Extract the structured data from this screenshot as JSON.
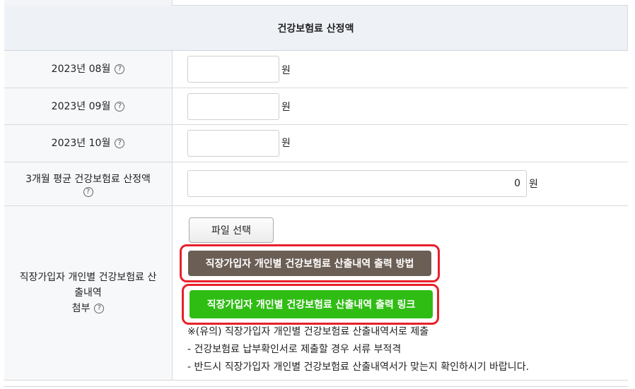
{
  "section": {
    "title": "건강보험료 산정액"
  },
  "rows": [
    {
      "label": "2023년 08월",
      "value": "",
      "unit": "원"
    },
    {
      "label": "2023년 09월",
      "value": "",
      "unit": "원"
    },
    {
      "label": "2023년 10월",
      "value": "",
      "unit": "원"
    }
  ],
  "average": {
    "label": "3개월 평균 건강보험료 산정액",
    "value": "0",
    "unit": "원"
  },
  "attachment": {
    "label_line1": "직장가입자 개인별 건강보험료 산",
    "label_line2": "출내역",
    "label_line3": "첨부",
    "file_button": "파일 선택",
    "howto_button": "직장가입자 개인별 건강보험료 산출내역 출력 방법",
    "link_button": "직장가입자 개인별 건강보험료 산출내역 출력 링크",
    "notes": [
      "※(유의) 직장가입자 개인별 건강보험료 산출내역서로 제출",
      "- 건강보험료 납부확인서로 제출할 경우 서류 부적격",
      "- 반드시 직장가입자 개인별 건강보험료 산출내역서가 맞는지 확인하시기 바랍니다."
    ]
  },
  "help_glyph": "?",
  "colors": {
    "highlight_ring": "#e8202a",
    "howto_button": "#6b5e55",
    "link_button": "#2fbd14",
    "header_bg": "#eef2f7"
  }
}
